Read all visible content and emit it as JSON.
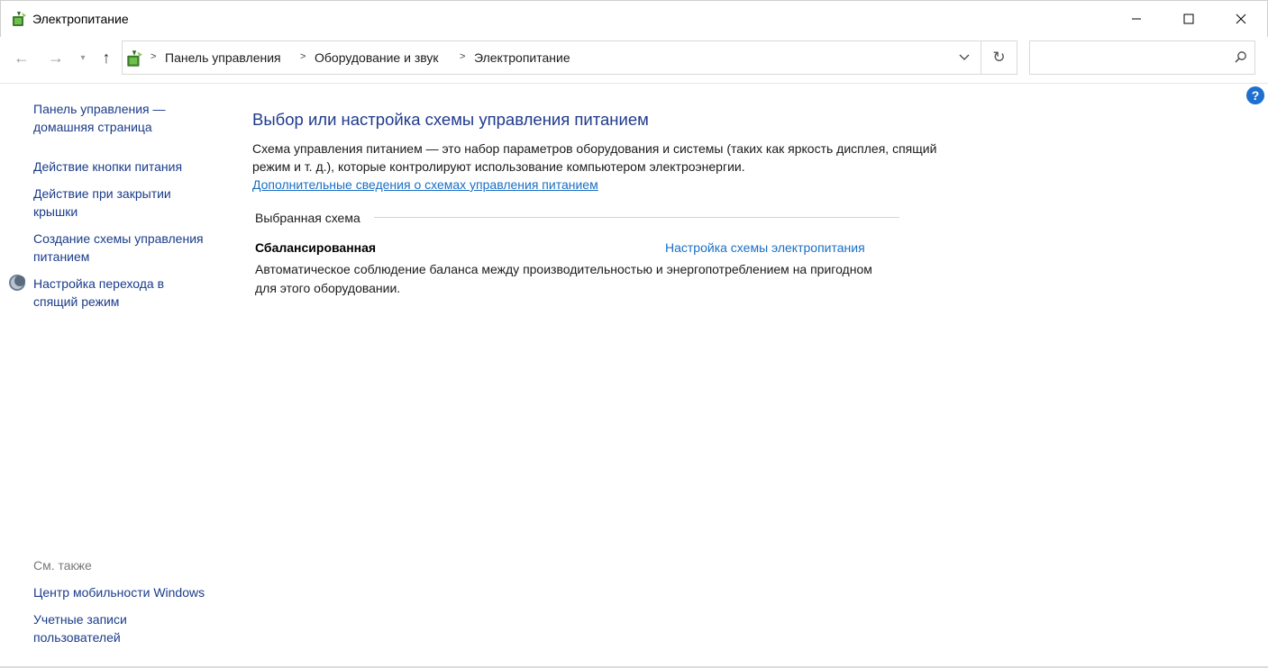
{
  "window": {
    "title": "Электропитание",
    "icon": "power-options-icon"
  },
  "address": {
    "breadcrumbs": [
      "Панель управления",
      "Оборудование и звук",
      "Электропитание"
    ],
    "search_placeholder": ""
  },
  "sidebar": {
    "links": [
      {
        "label": "Панель управления —\nдомашняя страница"
      },
      {
        "label": "Действие кнопки питания"
      },
      {
        "label": "Действие при закрытии\nкрышки"
      },
      {
        "label": "Создание схемы управления\nпитанием"
      },
      {
        "label": "Настройка перехода в\nспящий режим"
      }
    ],
    "see_also_label": "См. также",
    "see_also": [
      {
        "label": "Центр мобильности Windows"
      },
      {
        "label": "Учетные записи\nпользователей"
      }
    ]
  },
  "main": {
    "title": "Выбор или настройка схемы управления питанием",
    "description": "Схема управления питанием — это набор параметров оборудования и системы (таких как яркость дисплея, спящий режим и т. д.), которые контролируют использование компьютером электроэнергии.",
    "more_info_link": "Дополнительные сведения о схемах управления питанием",
    "group_label": "Выбранная схема",
    "plan": {
      "name": "Сбалансированная",
      "settings_link": "Настройка схемы электропитания",
      "description": "Автоматическое соблюдение баланса между производительностью и энергопотреблением на пригодном для этого оборудовании."
    }
  },
  "colors": {
    "link": "#1a6fc4",
    "title": "#1e3a8c",
    "help": "#1e6fd0"
  }
}
